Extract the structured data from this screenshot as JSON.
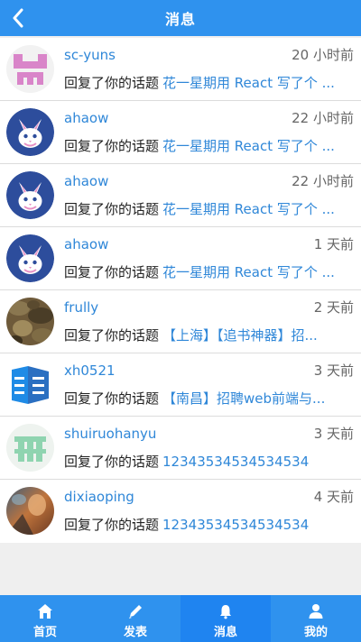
{
  "header": {
    "title": "消息"
  },
  "messages": [
    {
      "user": "sc-yuns",
      "time": "20 小时前",
      "action": "回复了你的话题",
      "topic": "花一星期用 React 写了个 ...",
      "avatar": "pink-pixel"
    },
    {
      "user": "ahaow",
      "time": "22 小时前",
      "action": "回复了你的话题",
      "topic": "花一星期用 React 写了个 ...",
      "avatar": "bunny"
    },
    {
      "user": "ahaow",
      "time": "22 小时前",
      "action": "回复了你的话题",
      "topic": "花一星期用 React 写了个 ...",
      "avatar": "bunny"
    },
    {
      "user": "ahaow",
      "time": "1 天前",
      "action": "回复了你的话题",
      "topic": "花一星期用 React 写了个 ...",
      "avatar": "bunny"
    },
    {
      "user": "frully",
      "time": "2 天前",
      "action": "回复了你的话题",
      "topic": "【上海】【追书神器】招...",
      "avatar": "camo"
    },
    {
      "user": "xh0521",
      "time": "3 天前",
      "action": "回复了你的话题",
      "topic": "【南昌】招聘web前端与...",
      "avatar": "blue-logo"
    },
    {
      "user": "shuiruohanyu",
      "time": "3 天前",
      "action": "回复了你的话题",
      "topic": "12343534534534534",
      "avatar": "green-pixel"
    },
    {
      "user": "dixiaoping",
      "time": "4 天前",
      "action": "回复了你的话题",
      "topic": "12343534534534534",
      "avatar": "photo"
    }
  ],
  "tabs": [
    {
      "label": "首页",
      "icon": "home-icon"
    },
    {
      "label": "发表",
      "icon": "pencil-icon"
    },
    {
      "label": "消息",
      "icon": "bell-icon",
      "active": true
    },
    {
      "label": "我的",
      "icon": "user-icon"
    }
  ],
  "colors": {
    "primary": "#2f92ee",
    "link": "#2f87d8",
    "active_tab": "#1f84f0"
  }
}
